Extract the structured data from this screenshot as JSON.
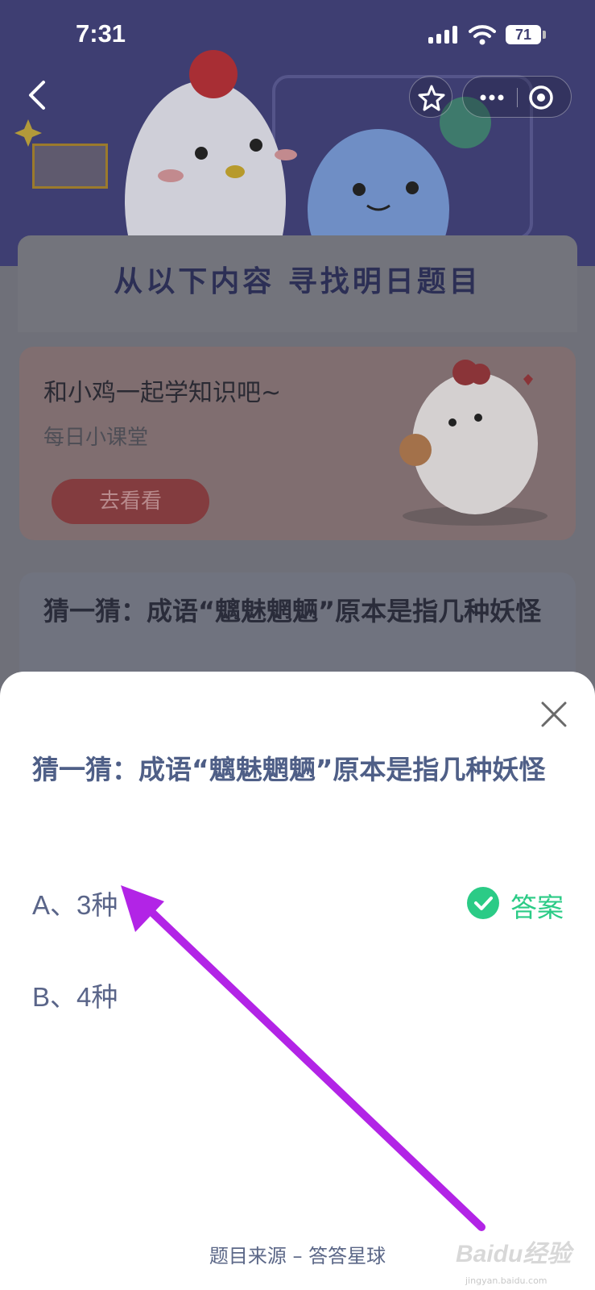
{
  "status_bar": {
    "time": "7:31",
    "battery": "71"
  },
  "nav": {
    "back_icon": "chevron-left-icon",
    "star_icon": "star-icon",
    "more_icon": "ellipsis-icon",
    "target_icon": "target-icon"
  },
  "background": {
    "banner_title": "从以下内容  寻找明日题目",
    "card_pink": {
      "title": "和小鸡一起学知识吧~",
      "subtitle": "每日小课堂",
      "button": "去看看"
    },
    "card_blue": {
      "title": "猜一猜：成语“魑魅魍魉”原本是指几种妖怪"
    }
  },
  "sheet": {
    "question": "猜一猜：成语“魑魅魍魉”原本是指几种妖怪",
    "options": [
      {
        "label": "A、3种",
        "correct": true
      },
      {
        "label": "B、4种",
        "correct": false
      }
    ],
    "answer_label": "答案",
    "footer": "题目来源 – 答答星球"
  },
  "watermark": {
    "text": "Baidu经验",
    "sub": "jingyan.baidu.com"
  },
  "colors": {
    "accent_green": "#2bcb86",
    "question_text": "#4f5f87",
    "arrow": "#b224e6",
    "overlay_dark": "#3e3e72"
  }
}
